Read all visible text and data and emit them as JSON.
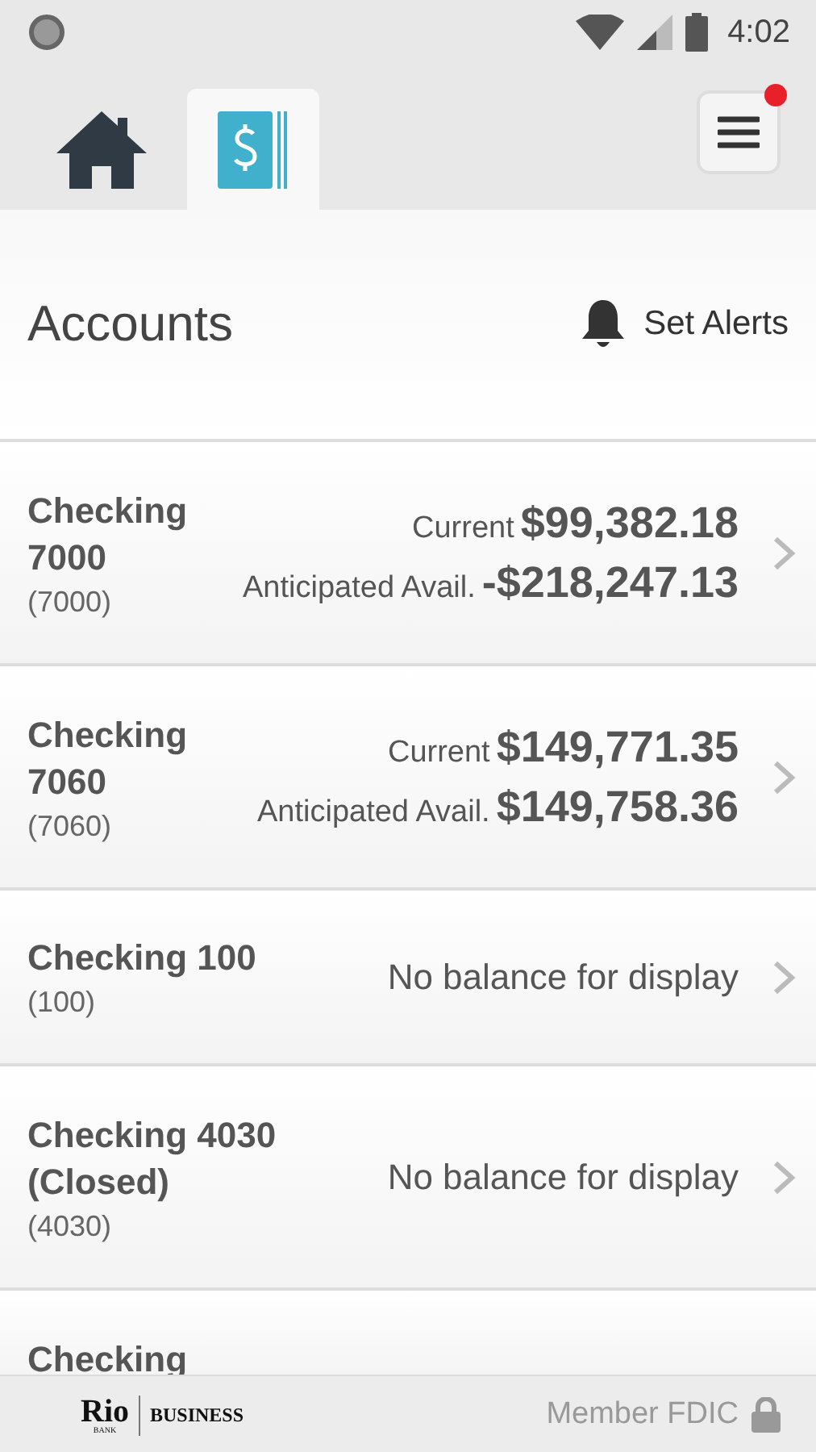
{
  "status_bar": {
    "time": "4:02"
  },
  "tabs": [
    {
      "kind": "home",
      "selected": false
    },
    {
      "kind": "accounts",
      "selected": true
    }
  ],
  "menu": {
    "notification": true
  },
  "header": {
    "title": "Accounts",
    "alerts_label": "Set Alerts"
  },
  "accounts": [
    {
      "kind": "balance",
      "name": "Checking 7000",
      "number": "(7000)",
      "current_label": "Current",
      "current": "$99,382.18",
      "avail_label": "Anticipated Avail.",
      "avail": "-$218,247.13"
    },
    {
      "kind": "balance",
      "name": "Checking 7060",
      "number": "(7060)",
      "current_label": "Current",
      "current": "$149,771.35",
      "avail_label": "Anticipated Avail.",
      "avail": "$149,758.36"
    },
    {
      "kind": "none",
      "name": "Checking 100",
      "number": "(100)",
      "message": "No balance for display"
    },
    {
      "kind": "none",
      "name": "Checking 4030 (Closed)",
      "number": "(4030)",
      "message": "No balance for display"
    },
    {
      "kind": "partial",
      "name": "Checking"
    }
  ],
  "footer": {
    "brand": "Rio",
    "brand_sub": "BANK",
    "division": "BUSINESS",
    "fdic": "Member FDIC"
  }
}
